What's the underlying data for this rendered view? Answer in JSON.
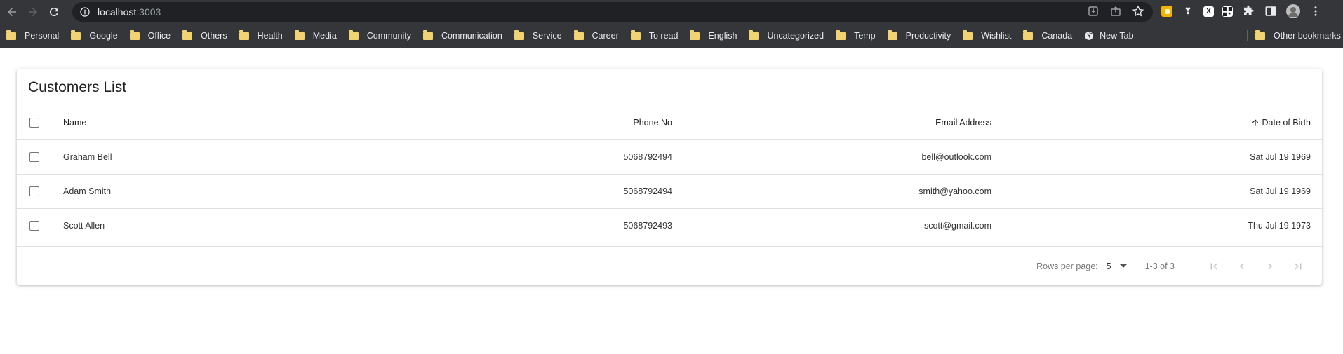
{
  "browser": {
    "url_host": "localhost",
    "url_port": ":3003",
    "bookmarks": [
      "Personal",
      "Google",
      "Office",
      "Others",
      "Health",
      "Media",
      "Community",
      "Communication",
      "Service",
      "Career",
      "To read",
      "English",
      "Uncategorized",
      "Temp",
      "Productivity",
      "Wishlist",
      "Canada"
    ],
    "new_tab": "New Tab",
    "other_bookmarks": "Other bookmarks"
  },
  "page": {
    "title": "Customers List",
    "columns": {
      "name": "Name",
      "phone": "Phone No",
      "email": "Email Address",
      "dob": "Date of Birth"
    },
    "rows": [
      {
        "name": "Graham Bell",
        "phone": "5068792494",
        "email": "bell@outlook.com",
        "dob": "Sat Jul 19 1969"
      },
      {
        "name": "Adam Smith",
        "phone": "5068792494",
        "email": "smith@yahoo.com",
        "dob": "Sat Jul 19 1969"
      },
      {
        "name": "Scott Allen",
        "phone": "5068792493",
        "email": "scott@gmail.com",
        "dob": "Thu Jul 19 1973"
      }
    ],
    "pagination": {
      "rows_per_page_label": "Rows per page:",
      "rows_per_page_value": "5",
      "range": "1-3 of 3"
    }
  },
  "colors": {
    "chrome_bg": "#35363a",
    "omnibox_bg": "#202124",
    "folder": "#f1d373"
  }
}
